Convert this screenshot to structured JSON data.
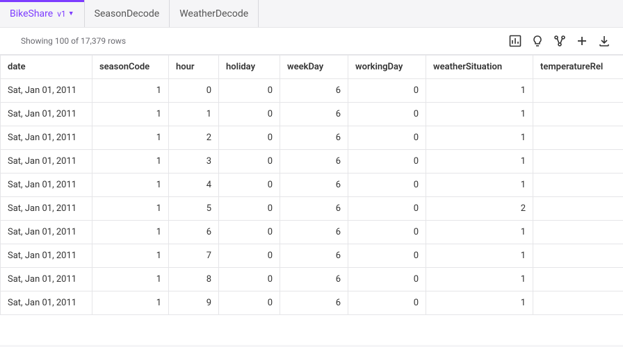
{
  "tabs": [
    {
      "label": "BikeShare",
      "version": "v1",
      "active": true
    },
    {
      "label": "SeasonDecode",
      "active": false
    },
    {
      "label": "WeatherDecode",
      "active": false
    }
  ],
  "row_info": "Showing  100 of 17,379 rows",
  "columns": [
    "date",
    "seasonCode",
    "hour",
    "holiday",
    "weekDay",
    "workingDay",
    "weatherSituation",
    "temperatureRel"
  ],
  "rows": [
    {
      "date": "Sat, Jan 01, 2011",
      "seasonCode": 1,
      "hour": 0,
      "holiday": 0,
      "weekDay": 6,
      "workingDay": 0,
      "weatherSituation": 1
    },
    {
      "date": "Sat, Jan 01, 2011",
      "seasonCode": 1,
      "hour": 1,
      "holiday": 0,
      "weekDay": 6,
      "workingDay": 0,
      "weatherSituation": 1
    },
    {
      "date": "Sat, Jan 01, 2011",
      "seasonCode": 1,
      "hour": 2,
      "holiday": 0,
      "weekDay": 6,
      "workingDay": 0,
      "weatherSituation": 1
    },
    {
      "date": "Sat, Jan 01, 2011",
      "seasonCode": 1,
      "hour": 3,
      "holiday": 0,
      "weekDay": 6,
      "workingDay": 0,
      "weatherSituation": 1
    },
    {
      "date": "Sat, Jan 01, 2011",
      "seasonCode": 1,
      "hour": 4,
      "holiday": 0,
      "weekDay": 6,
      "workingDay": 0,
      "weatherSituation": 1
    },
    {
      "date": "Sat, Jan 01, 2011",
      "seasonCode": 1,
      "hour": 5,
      "holiday": 0,
      "weekDay": 6,
      "workingDay": 0,
      "weatherSituation": 2
    },
    {
      "date": "Sat, Jan 01, 2011",
      "seasonCode": 1,
      "hour": 6,
      "holiday": 0,
      "weekDay": 6,
      "workingDay": 0,
      "weatherSituation": 1
    },
    {
      "date": "Sat, Jan 01, 2011",
      "seasonCode": 1,
      "hour": 7,
      "holiday": 0,
      "weekDay": 6,
      "workingDay": 0,
      "weatherSituation": 1
    },
    {
      "date": "Sat, Jan 01, 2011",
      "seasonCode": 1,
      "hour": 8,
      "holiday": 0,
      "weekDay": 6,
      "workingDay": 0,
      "weatherSituation": 1
    },
    {
      "date": "Sat, Jan 01, 2011",
      "seasonCode": 1,
      "hour": 9,
      "holiday": 0,
      "weekDay": 6,
      "workingDay": 0,
      "weatherSituation": 1
    }
  ]
}
